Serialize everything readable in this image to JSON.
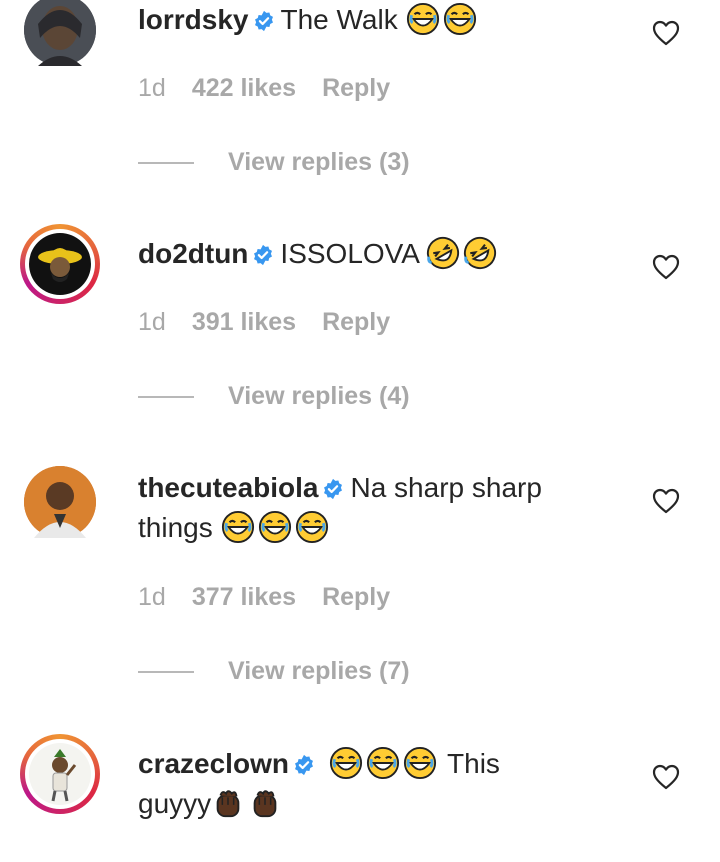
{
  "comments": [
    {
      "username": "lorrdsky",
      "text": "The Walk",
      "emojis": [
        "grinning-sweat",
        "grinning-sweat"
      ],
      "time": "1d",
      "likes": "422 likes",
      "reply": "Reply",
      "view_replies": "View replies (3)"
    },
    {
      "username": "do2dtun",
      "text": "ISSOLOVA",
      "emojis": [
        "rolling-laughing",
        "rolling-laughing"
      ],
      "time": "1d",
      "likes": "391 likes",
      "reply": "Reply",
      "view_replies": "View replies (4)"
    },
    {
      "username": "thecuteabiola",
      "text": "Na sharp sharp",
      "text2": "things",
      "emojis": [
        "grinning-sweat",
        "grinning-sweat",
        "grinning-sweat"
      ],
      "time": "1d",
      "likes": "377 likes",
      "reply": "Reply",
      "view_replies": "View replies (7)"
    },
    {
      "username": "crazeclown",
      "text": "This",
      "text2": "guyyy",
      "emojis": [
        "grinning-sweat",
        "grinning-sweat",
        "grinning-sweat"
      ],
      "emojis2": [
        "raised-fist",
        "raised-fist"
      ]
    }
  ],
  "colors": {
    "verified": "#3897f0",
    "meta": "#a8a8a8",
    "text": "#262626"
  }
}
